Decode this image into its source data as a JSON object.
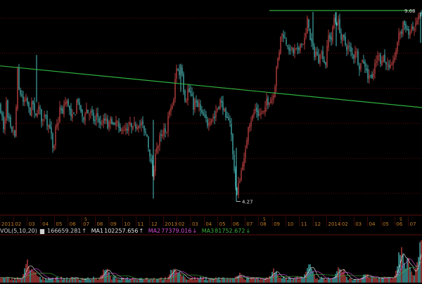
{
  "colors": {
    "background": "#000000",
    "grid": "#5a0e0e",
    "up_candle": "#d94a4a",
    "down_candle": "#4ec5c5",
    "trendline": "#2fae3f",
    "axis_text": "#c07a24",
    "ma1": "#e6e6e6",
    "ma2": "#d24fd2",
    "ma3": "#3fae3f",
    "vol_label": "#d0d0d0"
  },
  "price_chart": {
    "high_label": "9.68",
    "low_label": "4.27"
  },
  "time_axis": {
    "labels": [
      "2011",
      "02",
      "03",
      "04",
      "05",
      "06",
      "07",
      "08",
      "09",
      "10",
      "11",
      "12",
      "2013",
      "02",
      "03",
      "04",
      "05",
      "06",
      "07",
      "08",
      "09",
      "10",
      "11",
      "12",
      "2014",
      "02",
      "03",
      "04",
      "05",
      "06",
      "07"
    ]
  },
  "volume_panel": {
    "indicator": "VOL(5,10,20)",
    "vol_icon": "volume-bar-icon",
    "vol_value": "166659.281",
    "vol_arrow": "↑",
    "ma1_label": "MA1",
    "ma1_value": "102257.656",
    "ma1_arrow": "↑",
    "ma2_label": "MA2",
    "ma2_value": "77379.016",
    "ma2_arrow": "↓",
    "ma3_label": "MA3",
    "ma3_value": "81752.672",
    "ma3_arrow": "↓"
  },
  "chart_data": {
    "type": "candlestick",
    "ylim_price": [
      4.0,
      9.9
    ],
    "x_months": [
      "2011",
      "02",
      "03",
      "04",
      "05",
      "06",
      "07",
      "08",
      "09",
      "10",
      "11",
      "12",
      "2013",
      "02",
      "03",
      "04",
      "05",
      "06",
      "07",
      "08",
      "09",
      "10",
      "11",
      "12",
      "2014",
      "02",
      "03",
      "04",
      "05",
      "06",
      "07"
    ],
    "close_path": [
      [
        0,
        7.0
      ],
      [
        2,
        6.75
      ],
      [
        4,
        6.6
      ],
      [
        5,
        6.3
      ],
      [
        6,
        6.55
      ],
      [
        8,
        6.6
      ],
      [
        9,
        7.1
      ],
      [
        10,
        6.5
      ],
      [
        12,
        6.7
      ],
      [
        14,
        6.45
      ],
      [
        16,
        6.25
      ],
      [
        18,
        6.2
      ],
      [
        20,
        6.35
      ],
      [
        21,
        6.1
      ],
      [
        22,
        6.6
      ],
      [
        24,
        7.3
      ],
      [
        25,
        8.0
      ],
      [
        26,
        7.7
      ],
      [
        28,
        7.2
      ],
      [
        30,
        7.5
      ],
      [
        32,
        7.1
      ],
      [
        34,
        7.0
      ],
      [
        36,
        7.3
      ],
      [
        38,
        7.0
      ],
      [
        40,
        7.1
      ],
      [
        42,
        6.7
      ],
      [
        44,
        6.9
      ],
      [
        46,
        7.2
      ],
      [
        48,
        6.9
      ],
      [
        50,
        6.6
      ],
      [
        52,
        6.8
      ],
      [
        54,
        6.9
      ],
      [
        56,
        7.0
      ],
      [
        58,
        6.7
      ],
      [
        60,
        6.5
      ],
      [
        62,
        6.7
      ],
      [
        64,
        6.9
      ],
      [
        66,
        6.6
      ],
      [
        68,
        6.4
      ],
      [
        70,
        6.5
      ],
      [
        72,
        6.3
      ],
      [
        74,
        6.0
      ],
      [
        76,
        5.5
      ],
      [
        78,
        6.1
      ],
      [
        80,
        6.6
      ],
      [
        82,
        6.3
      ],
      [
        84,
        6.8
      ],
      [
        86,
        7.1
      ],
      [
        88,
        6.6
      ],
      [
        90,
        6.9
      ],
      [
        92,
        7.2
      ],
      [
        94,
        7.0
      ],
      [
        96,
        7.2
      ],
      [
        98,
        6.9
      ],
      [
        100,
        6.8
      ],
      [
        102,
        6.5
      ],
      [
        104,
        6.9
      ],
      [
        106,
        6.6
      ],
      [
        108,
        7.0
      ],
      [
        110,
        7.3
      ],
      [
        112,
        7.0
      ],
      [
        114,
        6.9
      ],
      [
        116,
        6.8
      ],
      [
        118,
        6.5
      ],
      [
        120,
        6.7
      ],
      [
        122,
        6.95
      ],
      [
        124,
        6.85
      ],
      [
        126,
        6.75
      ],
      [
        128,
        6.8
      ],
      [
        130,
        6.8
      ],
      [
        132,
        6.7
      ],
      [
        134,
        6.5
      ],
      [
        136,
        6.6
      ],
      [
        138,
        6.9
      ],
      [
        140,
        6.5
      ],
      [
        142,
        6.6
      ],
      [
        144,
        6.3
      ],
      [
        146,
        6.7
      ],
      [
        148,
        6.45
      ],
      [
        150,
        6.7
      ],
      [
        152,
        6.5
      ],
      [
        154,
        6.25
      ],
      [
        156,
        6.7
      ],
      [
        158,
        6.5
      ],
      [
        160,
        6.6
      ],
      [
        162,
        6.3
      ],
      [
        164,
        6.5
      ],
      [
        166,
        6.6
      ],
      [
        168,
        6.4
      ],
      [
        170,
        6.2
      ],
      [
        172,
        6.3
      ],
      [
        174,
        6.5
      ],
      [
        176,
        6.2
      ],
      [
        178,
        6.3
      ],
      [
        180,
        6.4
      ],
      [
        182,
        6.1
      ],
      [
        184,
        6.6
      ],
      [
        186,
        6.4
      ],
      [
        188,
        6.3
      ],
      [
        190,
        6.4
      ],
      [
        192,
        6.5
      ],
      [
        194,
        6.3
      ],
      [
        196,
        6.6
      ],
      [
        198,
        6.4
      ],
      [
        200,
        6.5
      ],
      [
        202,
        6.5
      ],
      [
        204,
        6.35
      ],
      [
        206,
        6.1
      ],
      [
        208,
        6.3
      ],
      [
        210,
        5.95
      ],
      [
        212,
        5.7
      ],
      [
        214,
        5.5
      ],
      [
        216,
        5.2
      ],
      [
        218,
        4.8
      ],
      [
        220,
        5.4
      ],
      [
        222,
        6.0
      ],
      [
        224,
        5.7
      ],
      [
        226,
        6.0
      ],
      [
        228,
        6.2
      ],
      [
        230,
        6.0
      ],
      [
        232,
        6.3
      ],
      [
        234,
        6.3
      ],
      [
        236,
        6.1
      ],
      [
        238,
        6.5
      ],
      [
        240,
        6.9
      ],
      [
        242,
        6.7
      ],
      [
        244,
        7.2
      ],
      [
        246,
        6.8
      ],
      [
        248,
        7.5
      ],
      [
        250,
        8.0
      ],
      [
        252,
        8.2
      ],
      [
        254,
        7.8
      ],
      [
        256,
        8.0
      ],
      [
        258,
        8.3
      ],
      [
        260,
        7.6
      ],
      [
        262,
        7.3
      ],
      [
        264,
        7.1
      ],
      [
        266,
        7.3
      ],
      [
        268,
        7.6
      ],
      [
        270,
        7.2
      ],
      [
        272,
        7.5
      ],
      [
        274,
        6.9
      ],
      [
        276,
        7.0
      ],
      [
        278,
        7.3
      ],
      [
        280,
        6.8
      ],
      [
        282,
        7.1
      ],
      [
        284,
        7.0
      ],
      [
        286,
        6.7
      ],
      [
        288,
        6.8
      ],
      [
        290,
        6.6
      ],
      [
        292,
        6.7
      ],
      [
        294,
        6.5
      ],
      [
        296,
        6.45
      ],
      [
        298,
        6.7
      ],
      [
        300,
        6.5
      ],
      [
        302,
        6.8
      ],
      [
        304,
        6.6
      ],
      [
        306,
        6.7
      ],
      [
        308,
        7.0
      ],
      [
        310,
        6.9
      ],
      [
        312,
        7.1
      ],
      [
        314,
        7.2
      ],
      [
        316,
        6.9
      ],
      [
        318,
        7.0
      ],
      [
        320,
        6.7
      ],
      [
        322,
        6.5
      ],
      [
        324,
        6.7
      ],
      [
        326,
        6.6
      ],
      [
        328,
        6.5
      ],
      [
        330,
        5.8
      ],
      [
        332,
        5.4
      ],
      [
        334,
        5.0
      ],
      [
        336,
        4.4
      ],
      [
        338,
        4.5
      ],
      [
        340,
        5.0
      ],
      [
        342,
        4.8
      ],
      [
        344,
        5.5
      ],
      [
        346,
        5.3
      ],
      [
        348,
        5.6
      ],
      [
        350,
        5.8
      ],
      [
        352,
        6.3
      ],
      [
        354,
        6.6
      ],
      [
        356,
        6.4
      ],
      [
        358,
        6.8
      ],
      [
        360,
        6.6
      ],
      [
        362,
        7.0
      ],
      [
        364,
        6.8
      ],
      [
        366,
        6.9
      ],
      [
        368,
        6.6
      ],
      [
        370,
        6.9
      ],
      [
        372,
        6.7
      ],
      [
        374,
        6.95
      ],
      [
        376,
        6.7
      ],
      [
        378,
        7.1
      ],
      [
        380,
        7.3
      ],
      [
        382,
        6.9
      ],
      [
        384,
        7.4
      ],
      [
        386,
        7.0
      ],
      [
        388,
        7.4
      ],
      [
        390,
        7.3
      ],
      [
        392,
        7.9
      ],
      [
        394,
        8.4
      ],
      [
        396,
        8.2
      ],
      [
        398,
        8.8
      ],
      [
        400,
        9.2
      ],
      [
        402,
        8.9
      ],
      [
        404,
        9.1
      ],
      [
        406,
        8.7
      ],
      [
        408,
        8.9
      ],
      [
        410,
        8.6
      ],
      [
        412,
        8.4
      ],
      [
        414,
        8.9
      ],
      [
        416,
        8.3
      ],
      [
        418,
        8.7
      ],
      [
        420,
        8.5
      ],
      [
        422,
        8.7
      ],
      [
        424,
        8.4
      ],
      [
        426,
        8.8
      ],
      [
        428,
        8.9
      ],
      [
        430,
        8.6
      ],
      [
        432,
        9.0
      ],
      [
        434,
        8.8
      ],
      [
        436,
        9.3
      ],
      [
        438,
        9.6
      ],
      [
        440,
        9.0
      ],
      [
        442,
        8.7
      ],
      [
        444,
        8.9
      ],
      [
        446,
        8.4
      ],
      [
        448,
        8.5
      ],
      [
        450,
        8.6
      ],
      [
        452,
        8.2
      ],
      [
        454,
        8.4
      ],
      [
        456,
        8.7
      ],
      [
        458,
        8.3
      ],
      [
        460,
        8.5
      ],
      [
        462,
        8.0
      ],
      [
        464,
        8.4
      ],
      [
        466,
        8.9
      ],
      [
        468,
        9.1
      ],
      [
        470,
        8.8
      ],
      [
        472,
        9.0
      ],
      [
        474,
        9.4
      ],
      [
        476,
        9.6
      ],
      [
        478,
        9.2
      ],
      [
        480,
        9.5
      ],
      [
        482,
        9.3
      ],
      [
        484,
        9.0
      ],
      [
        486,
        8.8
      ],
      [
        488,
        9.1
      ],
      [
        490,
        8.7
      ],
      [
        492,
        8.8
      ],
      [
        494,
        8.5
      ],
      [
        496,
        8.9
      ],
      [
        498,
        8.4
      ],
      [
        500,
        8.6
      ],
      [
        502,
        8.3
      ],
      [
        504,
        8.5
      ],
      [
        506,
        8.7
      ],
      [
        508,
        8.3
      ],
      [
        510,
        8.2
      ],
      [
        512,
        8.0
      ],
      [
        514,
        8.4
      ],
      [
        516,
        8.3
      ],
      [
        518,
        8.1
      ],
      [
        520,
        8.2
      ],
      [
        522,
        7.9
      ],
      [
        524,
        7.7
      ],
      [
        526,
        8.0
      ],
      [
        528,
        7.9
      ],
      [
        530,
        7.7
      ],
      [
        532,
        8.0
      ],
      [
        534,
        8.4
      ],
      [
        536,
        8.2
      ],
      [
        538,
        8.6
      ],
      [
        540,
        8.4
      ],
      [
        542,
        8.1
      ],
      [
        544,
        8.5
      ],
      [
        546,
        8.4
      ],
      [
        548,
        8.1
      ],
      [
        550,
        8.4
      ],
      [
        552,
        7.9
      ],
      [
        554,
        8.2
      ],
      [
        556,
        8.0
      ],
      [
        558,
        8.2
      ],
      [
        560,
        8.5
      ],
      [
        562,
        8.3
      ],
      [
        564,
        8.7
      ],
      [
        566,
        9.0
      ],
      [
        568,
        9.2
      ],
      [
        570,
        8.9
      ],
      [
        572,
        9.3
      ],
      [
        574,
        9.5
      ],
      [
        576,
        9.1
      ],
      [
        578,
        9.4
      ],
      [
        580,
        8.9
      ],
      [
        582,
        9.2
      ],
      [
        584,
        9.0
      ],
      [
        586,
        9.4
      ],
      [
        588,
        9.1
      ],
      [
        590,
        9.2
      ],
      [
        592,
        9.5
      ],
      [
        594,
        9.4
      ],
      [
        596,
        9.7
      ],
      [
        598,
        9.6
      ]
    ],
    "volume_peaks": [
      [
        40,
        0.55
      ],
      [
        48,
        0.35
      ],
      [
        150,
        0.4
      ],
      [
        248,
        0.5
      ],
      [
        256,
        0.3
      ],
      [
        340,
        0.25
      ],
      [
        390,
        0.35
      ],
      [
        440,
        0.45
      ],
      [
        484,
        0.5
      ],
      [
        520,
        0.25
      ],
      [
        570,
        0.9
      ],
      [
        580,
        0.6
      ],
      [
        598,
        1.0
      ]
    ]
  }
}
